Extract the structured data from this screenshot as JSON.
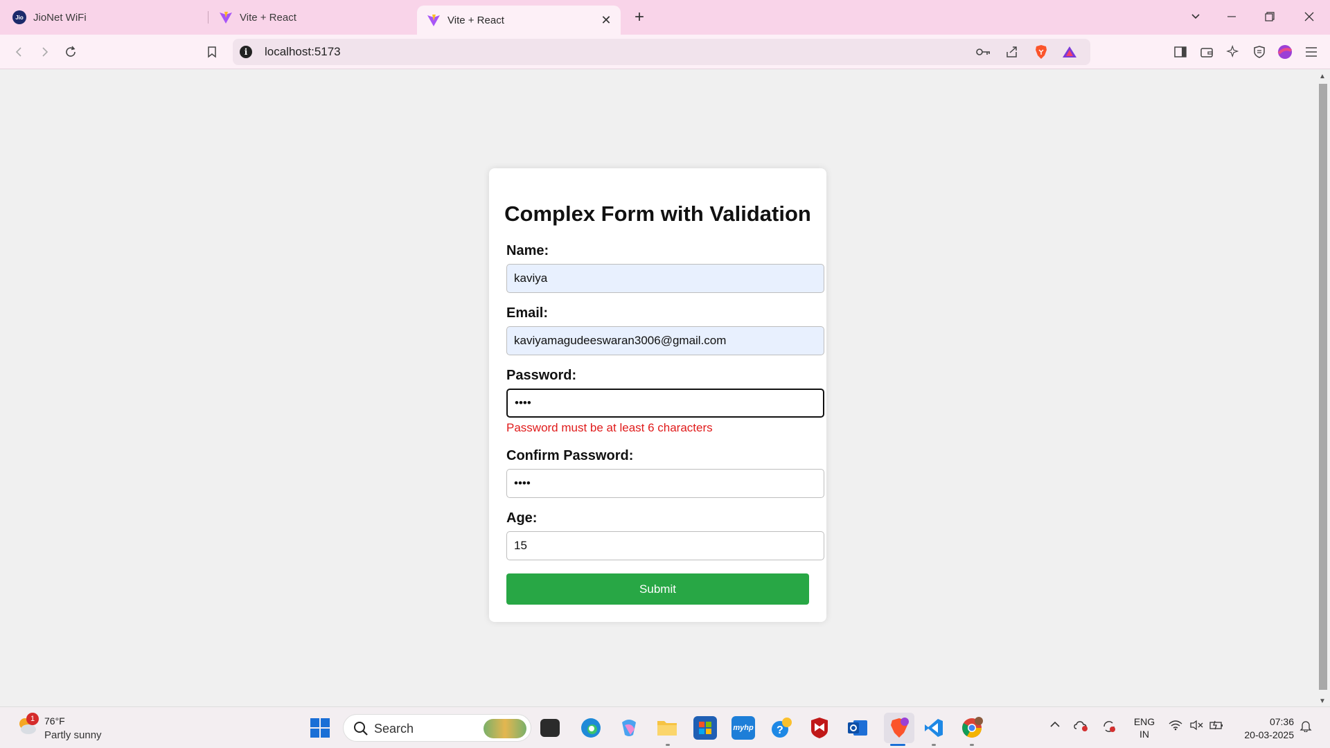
{
  "browser": {
    "tabs": [
      {
        "label": "JioNet WiFi",
        "icon": "jio-icon"
      },
      {
        "label": "Vite + React",
        "icon": "vite-icon"
      },
      {
        "label": "Vite + React",
        "icon": "vite-icon",
        "active": true
      }
    ],
    "url": "localhost:5173",
    "jio_logo": "Jio"
  },
  "form": {
    "title": "Complex Form with Validation",
    "name_label": "Name:",
    "name_value": "kaviya",
    "email_label": "Email:",
    "email_value": "kaviyamagudeeswaran3006@gmail.com",
    "password_label": "Password:",
    "password_value": "••••",
    "password_error": "Password must be at least 6 characters",
    "confirm_label": "Confirm Password:",
    "confirm_value": "••••",
    "age_label": "Age:",
    "age_value": "15",
    "submit_label": "Submit"
  },
  "taskbar": {
    "weather_badge": "1",
    "weather_temp": "76°F",
    "weather_desc": "Partly sunny",
    "search_placeholder": "Search",
    "lang_top": "ENG",
    "lang_bottom": "IN",
    "time": "07:36",
    "date": "20-03-2025"
  },
  "colors": {
    "tab_strip": "#f9d4e9",
    "submit": "#28a745",
    "error": "#e01b1b",
    "autofill": "#e8f0fe"
  }
}
